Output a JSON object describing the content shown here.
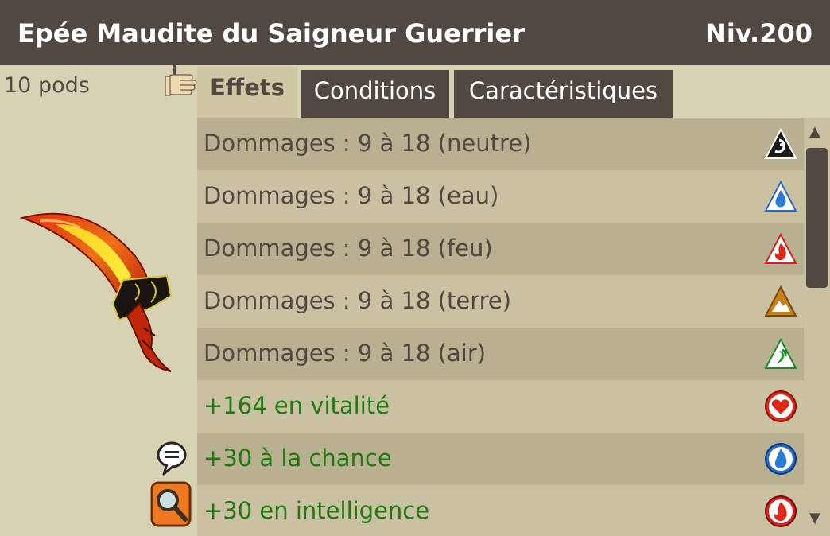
{
  "header": {
    "title": "Epée Maudite du Saigneur Guerrier",
    "level": "Niv.200"
  },
  "item": {
    "weight": "10 pods"
  },
  "tabs": [
    {
      "label": "Effets",
      "active": true
    },
    {
      "label": "Conditions",
      "active": false
    },
    {
      "label": "Caractéristiques",
      "active": false
    }
  ],
  "effects": [
    {
      "text": "Dommages : 9 à 18 (neutre)",
      "icon": "neutral-element-icon",
      "kind": "damage"
    },
    {
      "text": "Dommages : 9 à 18 (eau)",
      "icon": "water-element-icon",
      "kind": "damage"
    },
    {
      "text": "Dommages : 9 à 18 (feu)",
      "icon": "fire-element-icon",
      "kind": "damage"
    },
    {
      "text": "Dommages : 9 à 18 (terre)",
      "icon": "earth-element-icon",
      "kind": "damage"
    },
    {
      "text": "Dommages : 9 à 18 (air)",
      "icon": "air-element-icon",
      "kind": "damage"
    },
    {
      "text": "+164 en vitalité",
      "icon": "vitality-heart-icon",
      "kind": "stat"
    },
    {
      "text": "+30 à la chance",
      "icon": "chance-water-drop-icon",
      "kind": "stat"
    },
    {
      "text": "+30 en intelligence",
      "icon": "intelligence-fire-icon",
      "kind": "stat"
    }
  ],
  "colors": {
    "header_bg": "#514941",
    "panel_bg": "#d8d2b4",
    "row_dark": "#b8b090",
    "row_light": "#cac1a2",
    "damage_text": "#514941",
    "stat_text": "#207a10"
  }
}
